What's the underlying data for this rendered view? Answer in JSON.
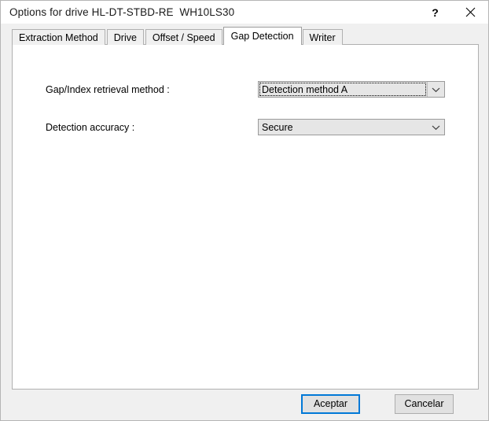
{
  "window": {
    "title": "Options for drive HL-DT-STBD-RE  WH10LS30",
    "help_label": "?",
    "close_label": "close-icon"
  },
  "tabs": [
    {
      "label": "Extraction Method",
      "active": false
    },
    {
      "label": "Drive",
      "active": false
    },
    {
      "label": "Offset / Speed",
      "active": false
    },
    {
      "label": "Gap Detection",
      "active": true
    },
    {
      "label": "Writer",
      "active": false
    }
  ],
  "fields": {
    "gap_method": {
      "label": "Gap/Index retrieval method :",
      "value": "Detection method A",
      "focused": true
    },
    "detection_accuracy": {
      "label": "Detection accuracy :",
      "value": "Secure",
      "focused": false
    }
  },
  "footer": {
    "ok_label": "Aceptar",
    "cancel_label": "Cancelar"
  },
  "colors": {
    "accent": "#0078d7",
    "window_bg": "#f0f0f0",
    "panel_bg": "#ffffff",
    "control_bg": "#e6e6e6",
    "border": "#b0b0b0"
  }
}
